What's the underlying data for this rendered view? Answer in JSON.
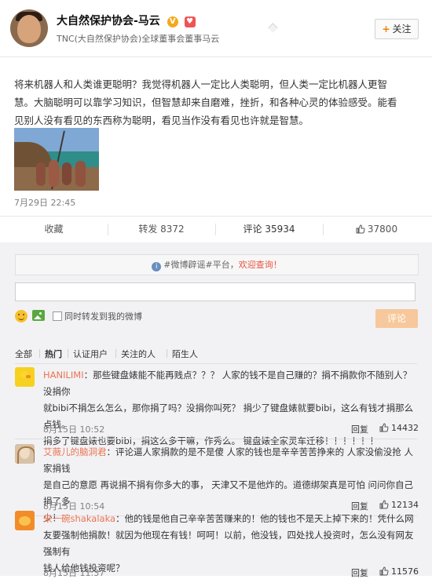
{
  "post": {
    "author_name": "大自然保护协会-马云",
    "author_badge": "V",
    "author_desc": "TNC(大自然保护协会)全球董事会董事马云",
    "follow_label": "关注",
    "text_lines": [
      "将来机器人和人类谁更聪明？我觉得机器人一定比人类聪明，但人类一定比机器人更智",
      "慧。大脑聪明可以靠学习知识，但智慧却来自磨难，挫折，和各种心灵的体验感受。能看",
      "见别人没有看见的东西称为聪明，看见当作没有看见也许就是智慧。"
    ],
    "timestamp": "7月29日 22:45"
  },
  "actions": {
    "collect": "收藏",
    "repost": "转发 8372",
    "comment": "评论 35934",
    "like": "37800"
  },
  "comment_panel": {
    "notice_prefix": "#微博辟谣#平台，",
    "notice_link": "欢迎查询！",
    "input_value": "",
    "repost_label": "同时转发到我的微博",
    "submit_label": "评论",
    "filters": [
      "全部",
      "热门",
      "认证用户",
      "关注的人",
      "陌生人"
    ]
  },
  "comments": [
    {
      "name": "HANILIMI",
      "lines": [
        "：那些键盘婊能不能再贱点？？？ 人家的钱不是自己赚的？捐不捐款你不随别人？没捐你",
        "就bibi不捐怎么怎么，那你捐了吗？没捐你叫死？ 捐少了键盘婊就要bibi，这么有钱才捐那么点钱。",
        "捐多了键盘婊也要bibi，捐这么多干嘛，作秀么。 键盘婊全家灵车迁移！！！！！！"
      ],
      "time": "8月15日 10:52",
      "reply": "回复",
      "likes": "14432"
    },
    {
      "name": "艾薇儿的脑洞君",
      "lines": [
        "：评论逼人家捐款的是不是傻 人家的钱也是辛辛苦苦挣来的 人家没偷没抢 人家捐钱",
        "是自己的意愿 再说捐不捐有你多大的事， 天津又不是他炸的。道德绑架真是可怕 问问你自己捐了多",
        "少！"
      ],
      "time": "8月15日 10:54",
      "reply": "回复",
      "likes": "12134"
    },
    {
      "name": "来一碗shakalaka",
      "lines": [
        "：他的钱是他自己辛辛苦苦赚来的！他的钱也不是天上掉下来的！凭什么网",
        "友要强制他捐款！就因为他现在有钱！呵呵！以前，他没钱，四处找人投资时，怎么没有网友强制有",
        "钱人给他钱投资呢？"
      ],
      "time": "8月15日 11:37",
      "reply": "回复",
      "likes": "11576"
    }
  ]
}
